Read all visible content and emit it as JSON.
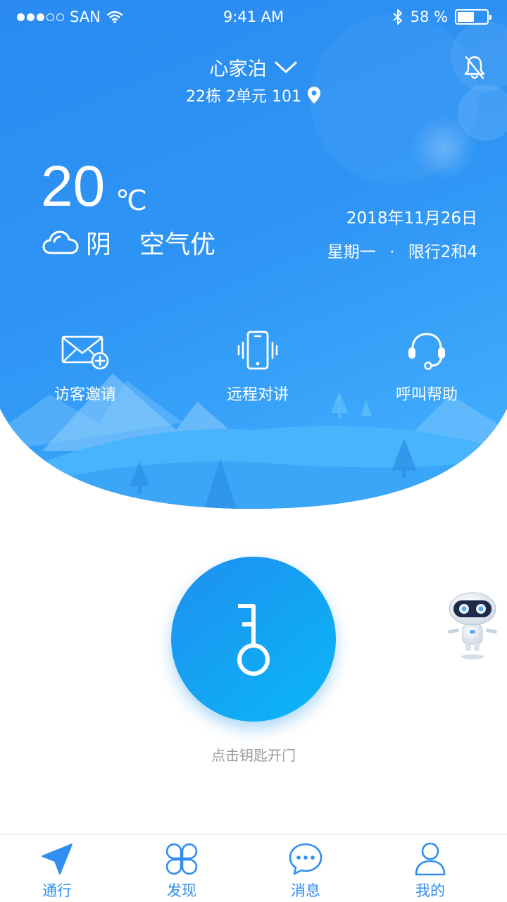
{
  "status_bar": {
    "carrier": "SAN",
    "time": "9:41 AM",
    "battery_text": "58 %",
    "battery_level": 0.58
  },
  "header": {
    "community": "心家泊",
    "address": "22栋 2单元 101"
  },
  "weather": {
    "temperature": "20",
    "unit": "℃",
    "condition": "阴",
    "air_quality": "空气优"
  },
  "date": {
    "date": "2018年11月26日",
    "weekday": "星期一",
    "separator": "·",
    "restriction": "限行2和4"
  },
  "actions": [
    {
      "label": "访客邀请",
      "icon": "envelope-plus-icon"
    },
    {
      "label": "远程对讲",
      "icon": "phone-vibrate-icon"
    },
    {
      "label": "呼叫帮助",
      "icon": "headset-icon"
    }
  ],
  "unlock": {
    "hint": "点击钥匙开门",
    "icon": "key-icon"
  },
  "tabs": [
    {
      "label": "通行",
      "icon": "send-icon",
      "active": true
    },
    {
      "label": "发现",
      "icon": "grid-clover-icon",
      "active": false
    },
    {
      "label": "消息",
      "icon": "chat-bubble-icon",
      "active": false
    },
    {
      "label": "我的",
      "icon": "user-icon",
      "active": false
    }
  ],
  "colors": {
    "primary": "#2f8ef0",
    "header_top": "#2d8ff0",
    "header_bottom": "#3da6fb",
    "hint_gray": "#9a9a9a"
  }
}
